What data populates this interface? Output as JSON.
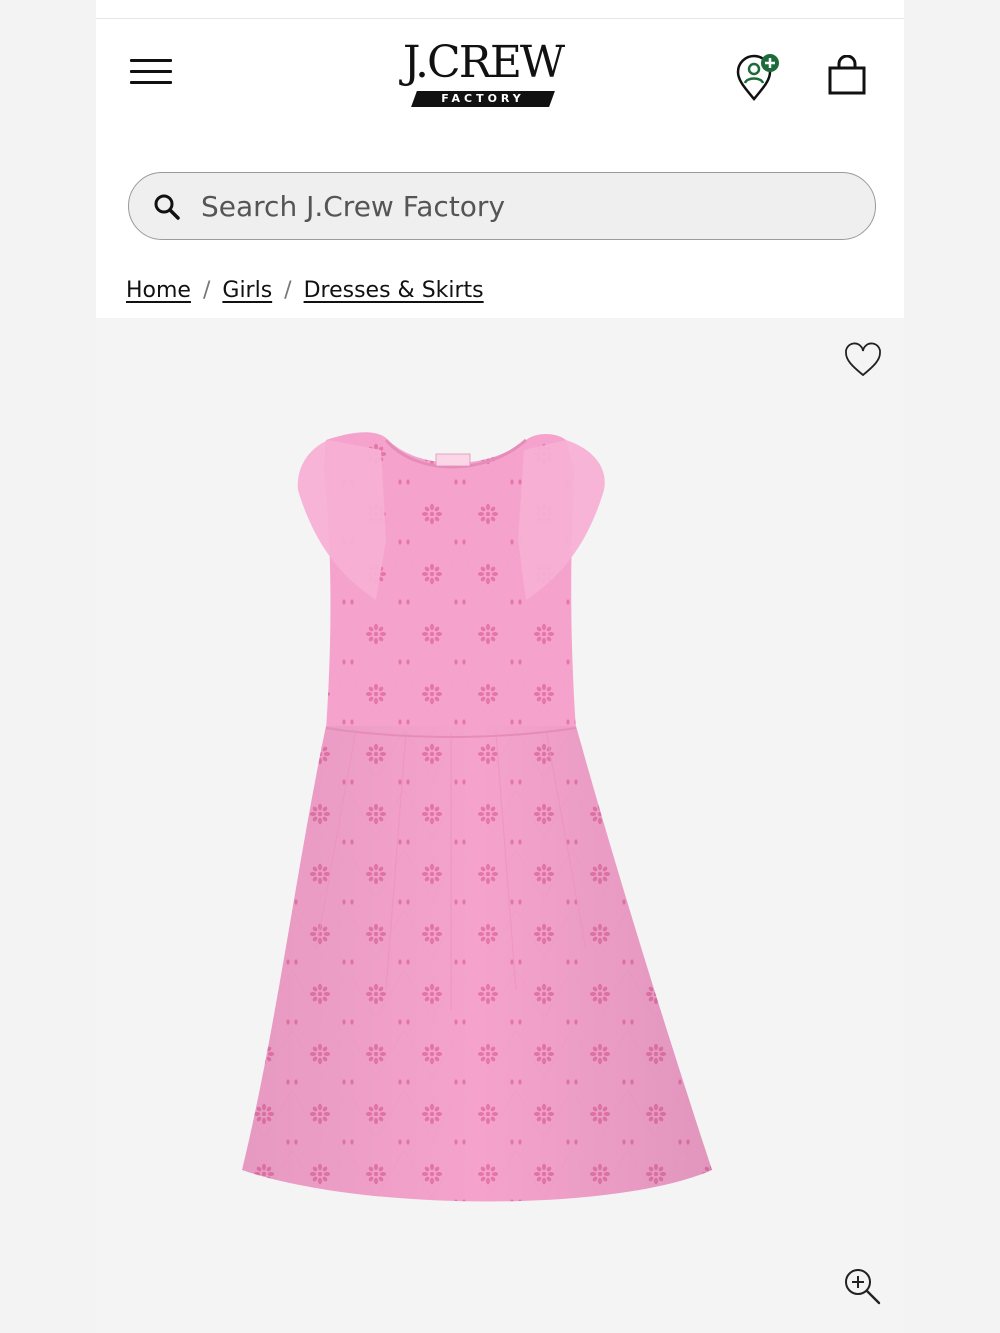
{
  "header": {
    "logo_text": "J.CREW",
    "logo_subtext": "FACTORY",
    "menu_icon": "hamburger-menu-icon",
    "loyalty_icon": "rewards-location-plus-icon",
    "bag_icon": "shopping-bag-icon"
  },
  "search": {
    "placeholder": "Search J.Crew Factory",
    "icon": "search-icon"
  },
  "breadcrumb": {
    "items": [
      {
        "label": "Home"
      },
      {
        "label": "Girls"
      },
      {
        "label": "Dresses & Skirts"
      }
    ],
    "separator": "/"
  },
  "product_image": {
    "alt": "Pink eyelet ruffle-sleeve dress",
    "dress_color": "#f5a3cd",
    "background_color": "#f4f4f4",
    "favorite_icon": "heart-outline-icon",
    "zoom_icon": "zoom-in-icon"
  },
  "colors": {
    "loyalty_accent": "#1e6b3a",
    "text": "#111111"
  }
}
